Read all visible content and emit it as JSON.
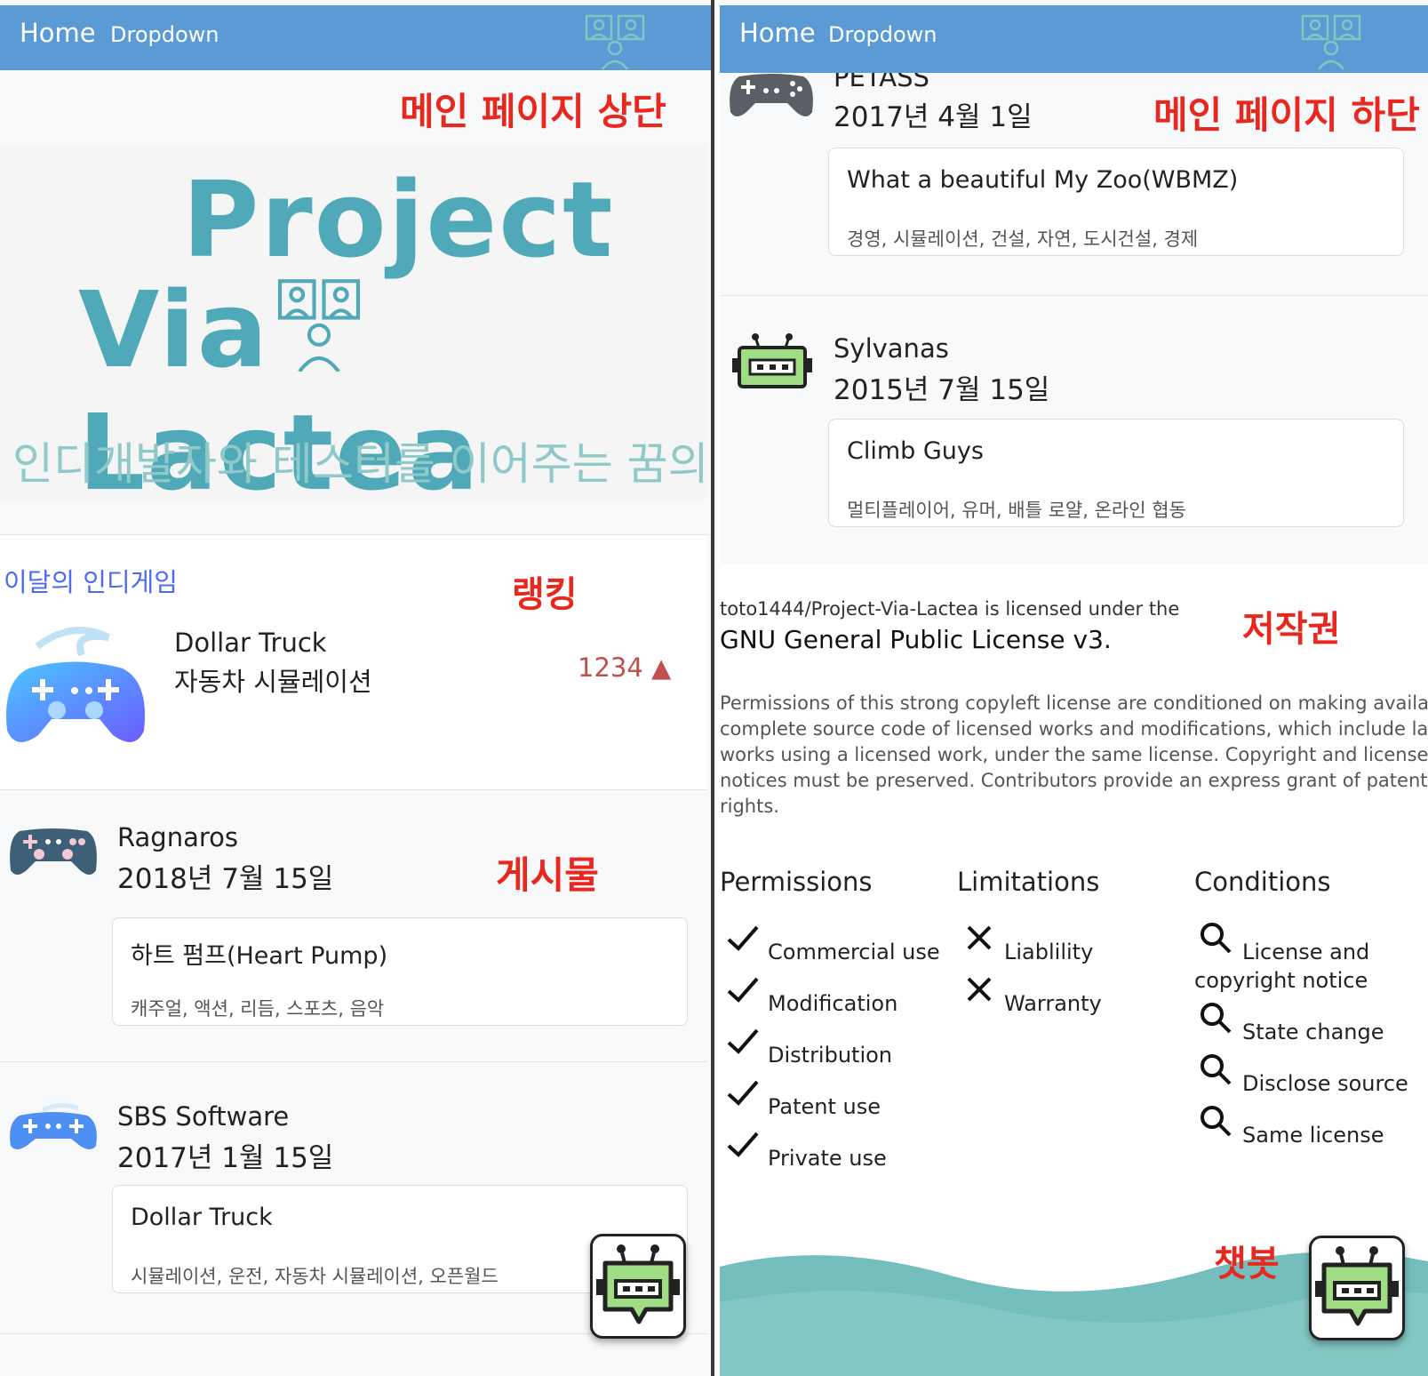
{
  "nav": {
    "home": "Home",
    "dropdown": "Dropdown"
  },
  "annotations": {
    "top": "메인 페이지 상단",
    "ranking": "랭킹",
    "posts": "게시물",
    "bottom": "메인 페이지 하단",
    "copyright": "저작권",
    "chatbot": "챗봇"
  },
  "hero": {
    "line1": "Project",
    "line2a": "Via",
    "line2b": "Lactea",
    "subtitle": "인디개발자와 테스터를 이어주는 꿈의 다리"
  },
  "ranking": {
    "heading": "이달의 인디게임",
    "title": "Dollar Truck",
    "genre": "자동차 시뮬레이션",
    "count": "1234 ▲"
  },
  "posts_left": [
    {
      "name": "Ragnaros",
      "date": "2018년 7월 15일",
      "title": "하트 펌프(Heart Pump)",
      "tags": "캐주얼, 액션, 리듬, 스포츠, 음악"
    },
    {
      "name": "SBS Software",
      "date": "2017년 1월 15일",
      "title": "Dollar Truck",
      "tags": "시뮬레이션, 운전, 자동차 시뮬레이션, 오픈월드"
    }
  ],
  "posts_right": [
    {
      "name": "PETASS",
      "date": "2017년 4월 1일",
      "title": "What a beautiful My Zoo(WBMZ)",
      "tags": "경영, 시뮬레이션, 건설, 자연, 도시건설, 경제"
    },
    {
      "name": "Sylvanas",
      "date": "2015년 7월 15일",
      "title": "Climb Guys",
      "tags": "멀티플레이어, 유머, 배틀 로얄, 온라인 협동"
    }
  ],
  "license": {
    "repo_line": "toto1444/Project-Via-Lactea is licensed under the",
    "name": "GNU General Public License v3.",
    "desc_lines": [
      "Permissions of this strong copyleft license are conditioned on making available",
      "complete source code of licensed works and modifications, which include larger",
      "works using a licensed work, under the same license. Copyright and license",
      "notices must be preserved. Contributors provide an express grant of patent",
      "rights."
    ],
    "permissions": {
      "heading": "Permissions",
      "items": [
        "Commercial use",
        "Modification",
        "Distribution",
        "Patent use",
        "Private use"
      ]
    },
    "limitations": {
      "heading": "Limitations",
      "items": [
        "Liablility",
        "Warranty"
      ]
    },
    "conditions": {
      "heading": "Conditions",
      "items": [
        "License and",
        "copyright notice",
        "State change",
        "Disclose source",
        "Same license"
      ]
    }
  },
  "colors": {
    "navbar": "#5b9bd5",
    "brand": "#4fa9b8",
    "annotation": "#e8281e",
    "ranking_heading": "#4a6cf0",
    "rank_count": "#c0504d",
    "wave": "#74bfbd"
  }
}
